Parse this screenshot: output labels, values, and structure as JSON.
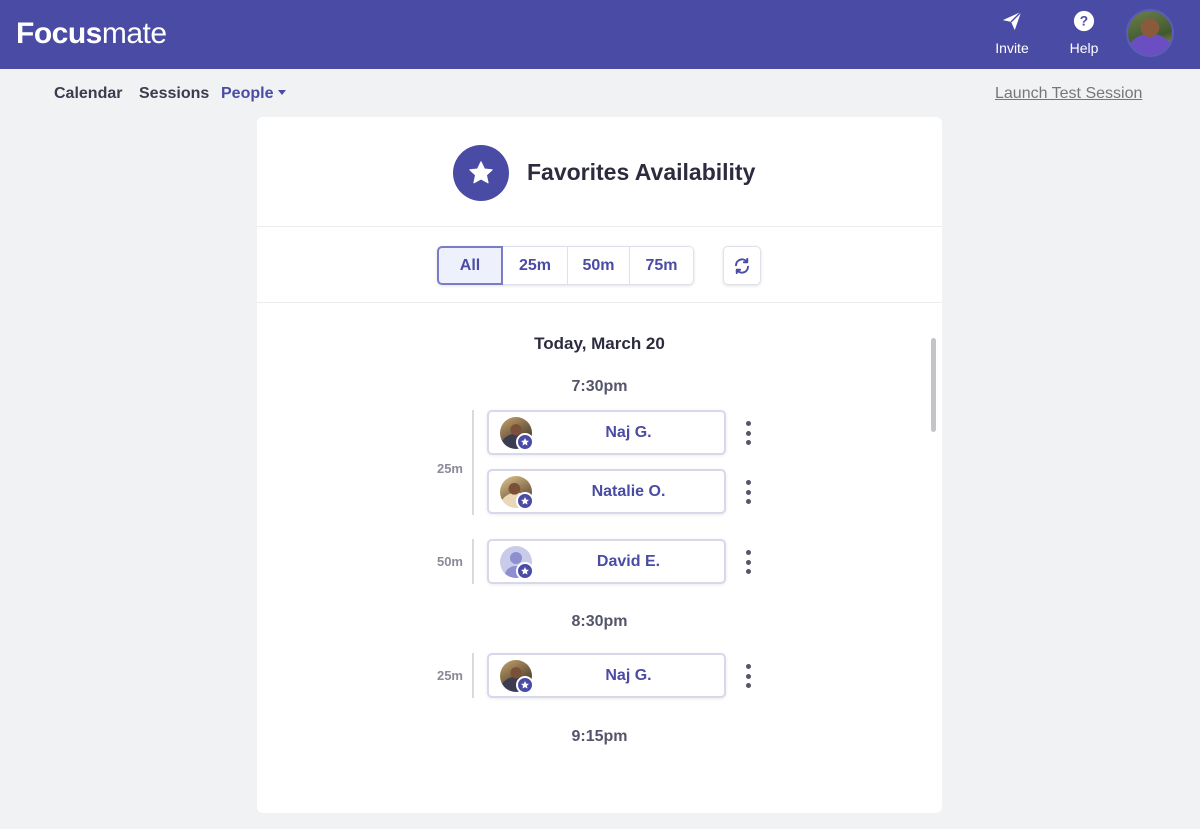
{
  "app": {
    "logo_bold": "Focus",
    "logo_light": "mate",
    "actions": [
      {
        "label": "Invite",
        "icon": "paper-plane-icon"
      },
      {
        "label": "Help",
        "icon": "question-circle-icon"
      }
    ],
    "avatar": "user-avatar"
  },
  "subnav": {
    "links": [
      "Calendar",
      "Sessions",
      "People"
    ],
    "active": "People",
    "launch_test": "Launch Test Session"
  },
  "card": {
    "title": "Favorites Availability",
    "title_icon": "star-icon",
    "filters": [
      "All",
      "25m",
      "50m",
      "75m"
    ],
    "selected_filter": "All",
    "refresh_icon": "refresh-icon"
  },
  "schedule": {
    "date": "Today, March 20",
    "times": [
      "7:30pm",
      "8:30pm",
      "9:15pm"
    ],
    "groups": [
      {
        "time": "7:30pm",
        "duration": "25m",
        "people": [
          "Naj G.",
          "Natalie O."
        ]
      },
      {
        "time": "7:30pm",
        "duration": "50m",
        "people": [
          "David E."
        ]
      },
      {
        "time": "8:30pm",
        "duration": "25m",
        "people": [
          "Naj G."
        ]
      }
    ]
  },
  "colors": {
    "brand": "#4a4ba5",
    "background": "#f1f2f4"
  }
}
